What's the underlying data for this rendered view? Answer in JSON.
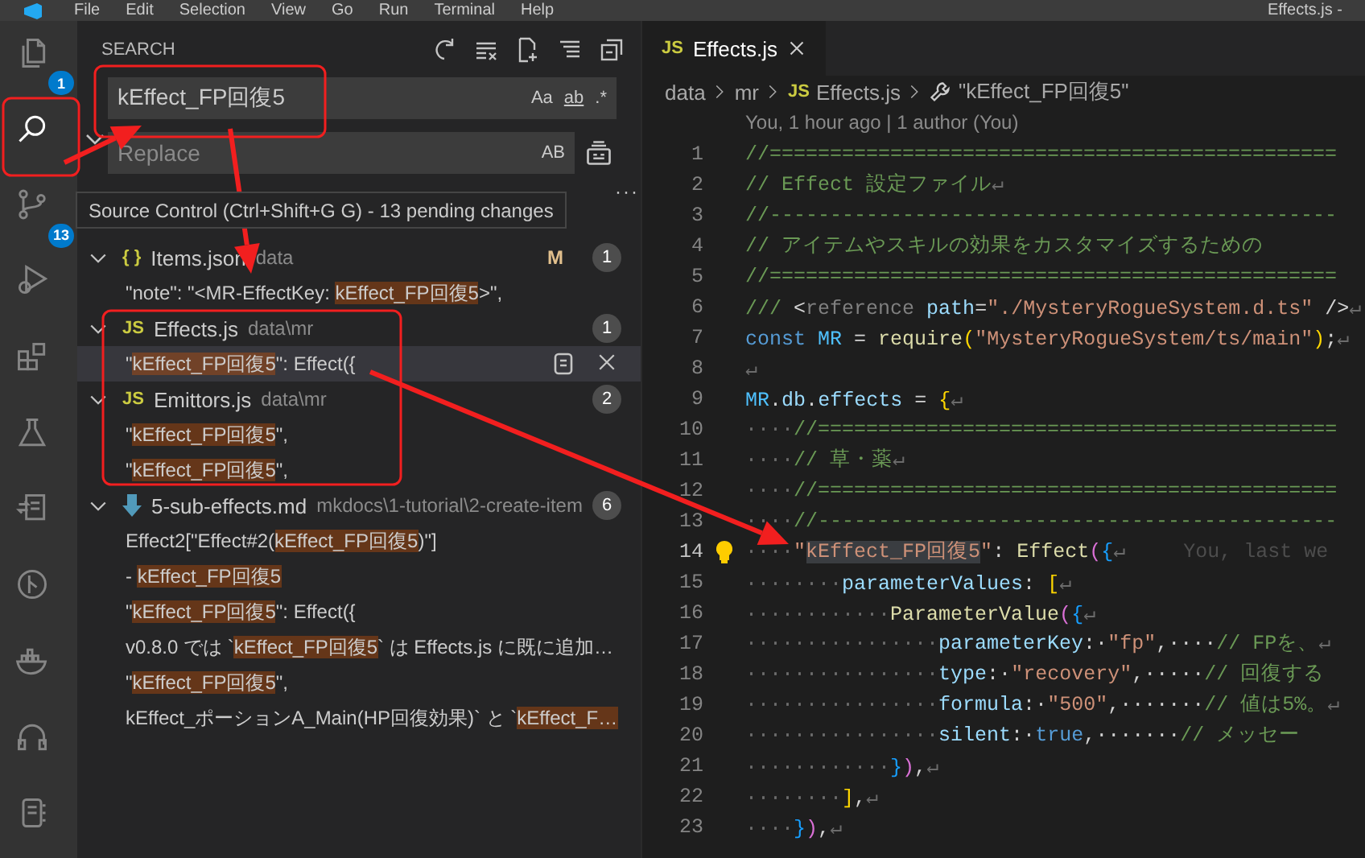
{
  "title_bar": {
    "menu": [
      "File",
      "Edit",
      "Selection",
      "View",
      "Go",
      "Run",
      "Terminal",
      "Help"
    ],
    "title": "Effects.js -"
  },
  "activity_bar": {
    "items": [
      {
        "kind": "explorer",
        "selected": false,
        "badge": "1"
      },
      {
        "kind": "search",
        "selected": true
      },
      {
        "kind": "scm",
        "selected": false,
        "badge": "13"
      },
      {
        "kind": "debug",
        "selected": false
      },
      {
        "kind": "extensions",
        "selected": false
      },
      {
        "kind": "testing",
        "selected": false
      },
      {
        "kind": "remote",
        "selected": false
      },
      {
        "kind": "graph",
        "selected": false
      },
      {
        "kind": "docker",
        "selected": false
      },
      {
        "kind": "headphones",
        "selected": false
      },
      {
        "kind": "notebook",
        "selected": false
      }
    ]
  },
  "tooltip": "Source Control (Ctrl+Shift+G G) - 13 pending changes",
  "sidebar": {
    "title": "SEARCH",
    "search": {
      "value": "kEffect_FP回復5",
      "options": [
        "Aa",
        "ab",
        ".*"
      ]
    },
    "replace": {
      "placeholder": "Replace",
      "options": [
        "AB"
      ]
    },
    "more": "···",
    "files": [
      {
        "name": "Items.json",
        "path": "data",
        "icon": {
          "kind": "json",
          "text": "{ }"
        },
        "status": "M",
        "count": "1",
        "expanded": true,
        "matches": [
          {
            "selected": false,
            "segments": [
              {
                "text": "\"note\": \"<MR-EffectKey: ",
                "match": false
              },
              {
                "text": "kEffect_FP回復5",
                "match": true
              },
              {
                "text": ">\",",
                "match": false
              }
            ]
          }
        ]
      },
      {
        "name": "Effects.js",
        "path": "data\\mr",
        "icon": {
          "kind": "js",
          "text": "JS"
        },
        "count": "1",
        "expanded": true,
        "matches": [
          {
            "selected": true,
            "segments": [
              {
                "text": "\"",
                "match": false
              },
              {
                "text": "kEffect_FP回復5",
                "match": true
              },
              {
                "text": "\": Effect({",
                "match": false
              }
            ]
          }
        ]
      },
      {
        "name": "Emittors.js",
        "path": "data\\mr",
        "icon": {
          "kind": "js",
          "text": "JS"
        },
        "count": "2",
        "expanded": true,
        "matches": [
          {
            "selected": false,
            "segments": [
              {
                "text": "\"",
                "match": false
              },
              {
                "text": "kEffect_FP回復5",
                "match": true
              },
              {
                "text": "\",",
                "match": false
              }
            ]
          },
          {
            "selected": false,
            "segments": [
              {
                "text": "\"",
                "match": false
              },
              {
                "text": "kEffect_FP回復5",
                "match": true
              },
              {
                "text": "\",",
                "match": false
              }
            ]
          }
        ]
      },
      {
        "name": "5-sub-effects.md",
        "path": "mkdocs\\1-tutorial\\2-create-item",
        "icon": {
          "kind": "markdown"
        },
        "count": "6",
        "expanded": true,
        "matches": [
          {
            "selected": false,
            "segments": [
              {
                "text": "Effect2[\"Effect#2(",
                "match": false
              },
              {
                "text": "kEffect_FP回復5",
                "match": true
              },
              {
                "text": ")\"]",
                "match": false
              }
            ]
          },
          {
            "selected": false,
            "segments": [
              {
                "text": "- ",
                "match": false
              },
              {
                "text": "kEffect_FP回復5",
                "match": true
              }
            ]
          },
          {
            "selected": false,
            "segments": [
              {
                "text": "\"",
                "match": false
              },
              {
                "text": "kEffect_FP回復5",
                "match": true
              },
              {
                "text": "\": Effect({",
                "match": false
              }
            ]
          },
          {
            "selected": false,
            "segments": [
              {
                "text": "v0.8.0 では `",
                "match": false
              },
              {
                "text": "kEffect_FP回復5",
                "match": true
              },
              {
                "text": "` は Effects.js に既に追加…",
                "match": false
              }
            ]
          },
          {
            "selected": false,
            "segments": [
              {
                "text": "\"",
                "match": false
              },
              {
                "text": "kEffect_FP回復5",
                "match": true
              },
              {
                "text": "\",",
                "match": false
              }
            ]
          },
          {
            "selected": false,
            "segments": [
              {
                "text": "kEffect_ポーションA_Main(HP回復効果)` と `",
                "match": false
              },
              {
                "text": "kEffect_F…",
                "match": true
              }
            ]
          }
        ]
      }
    ]
  },
  "editor": {
    "tabs": [
      {
        "label": "Effects.js",
        "icon": "JS",
        "selected": true
      }
    ],
    "breadcrumb": [
      {
        "kind": "folder",
        "text": "data"
      },
      {
        "kind": "folder",
        "text": "mr"
      },
      {
        "kind": "js",
        "icon": "JS",
        "text": "Effects.js"
      },
      {
        "kind": "symbol",
        "text": "\"kEffect_FP回復5\""
      }
    ],
    "blame": "You, 1 hour ago | 1 author (You)",
    "lines": [
      {
        "number": "1",
        "current": false,
        "lightbulb": false,
        "tokens": [
          {
            "kind": "comment",
            "text": "//==============================================="
          }
        ]
      },
      {
        "number": "2",
        "current": false,
        "lightbulb": false,
        "tokens": [
          {
            "kind": "comment",
            "text": "// Effect 設定ファイル"
          },
          {
            "kind": "eol",
            "text": "↵"
          }
        ]
      },
      {
        "number": "3",
        "current": false,
        "lightbulb": false,
        "tokens": [
          {
            "kind": "comment",
            "text": "//-----------------------------------------------"
          }
        ]
      },
      {
        "number": "4",
        "current": false,
        "lightbulb": false,
        "tokens": [
          {
            "kind": "comment",
            "text": "// アイテムやスキルの効果をカスタマイズするための"
          }
        ]
      },
      {
        "number": "5",
        "current": false,
        "lightbulb": false,
        "tokens": [
          {
            "kind": "comment",
            "text": "//==============================================="
          }
        ]
      },
      {
        "number": "6",
        "current": false,
        "lightbulb": false,
        "tokens": [
          {
            "kind": "comment",
            "text": "/// "
          },
          {
            "kind": "plain",
            "text": "<"
          },
          {
            "kind": "tag",
            "text": "reference"
          },
          {
            "kind": "property",
            "text": " path"
          },
          {
            "kind": "plain",
            "text": "="
          },
          {
            "kind": "string",
            "text": "\"./MysteryRogueSystem.d.ts\""
          },
          {
            "kind": "plain",
            "text": " />"
          },
          {
            "kind": "eol",
            "text": "↵"
          }
        ]
      },
      {
        "number": "7",
        "current": false,
        "lightbulb": false,
        "tokens": [
          {
            "kind": "keyword",
            "text": "const "
          },
          {
            "kind": "variable",
            "text": "MR"
          },
          {
            "kind": "plain",
            "text": " = "
          },
          {
            "kind": "function",
            "text": "require"
          },
          {
            "kind": "bracket",
            "text": "("
          },
          {
            "kind": "string",
            "text": "\"MysteryRogueSystem/ts/main\""
          },
          {
            "kind": "bracket",
            "text": ")"
          },
          {
            "kind": "plain",
            "text": ";"
          },
          {
            "kind": "eol",
            "text": "↵"
          }
        ]
      },
      {
        "number": "8",
        "current": false,
        "lightbulb": false,
        "tokens": [
          {
            "kind": "eol",
            "text": "↵"
          }
        ]
      },
      {
        "number": "9",
        "current": false,
        "lightbulb": false,
        "tokens": [
          {
            "kind": "variable",
            "text": "MR"
          },
          {
            "kind": "plain",
            "text": "."
          },
          {
            "kind": "property",
            "text": "db"
          },
          {
            "kind": "plain",
            "text": "."
          },
          {
            "kind": "property",
            "text": "effects"
          },
          {
            "kind": "plain",
            "text": " = "
          },
          {
            "kind": "bracket",
            "text": "{"
          },
          {
            "kind": "eol",
            "text": "↵"
          }
        ]
      },
      {
        "number": "10",
        "current": false,
        "lightbulb": false,
        "tokens": [
          {
            "kind": "whitespace",
            "text": "····"
          },
          {
            "kind": "comment",
            "text": "//==========================================="
          }
        ]
      },
      {
        "number": "11",
        "current": false,
        "lightbulb": false,
        "tokens": [
          {
            "kind": "whitespace",
            "text": "····"
          },
          {
            "kind": "comment",
            "text": "// 草・薬"
          },
          {
            "kind": "eol",
            "text": "↵"
          }
        ]
      },
      {
        "number": "12",
        "current": false,
        "lightbulb": false,
        "tokens": [
          {
            "kind": "whitespace",
            "text": "····"
          },
          {
            "kind": "comment",
            "text": "//==========================================="
          }
        ]
      },
      {
        "number": "13",
        "current": false,
        "lightbulb": false,
        "tokens": [
          {
            "kind": "whitespace",
            "text": "····"
          },
          {
            "kind": "comment",
            "text": "//-------------------------------------------"
          }
        ]
      },
      {
        "number": "14",
        "current": true,
        "lightbulb": true,
        "blame": "You, last we",
        "tokens": [
          {
            "kind": "whitespace",
            "text": "····"
          },
          {
            "kind": "string",
            "text": "\""
          },
          {
            "kind": "selection",
            "text": "kEffect_FP回復5"
          },
          {
            "kind": "string",
            "text": "\""
          },
          {
            "kind": "plain",
            "text": ": "
          },
          {
            "kind": "function",
            "text": "Effect"
          },
          {
            "kind": "bracket2",
            "text": "("
          },
          {
            "kind": "bracket3",
            "text": "{"
          },
          {
            "kind": "eol",
            "text": "↵"
          }
        ]
      },
      {
        "number": "15",
        "current": false,
        "lightbulb": false,
        "tokens": [
          {
            "kind": "whitespace",
            "text": "········"
          },
          {
            "kind": "property",
            "text": "parameterValues"
          },
          {
            "kind": "plain",
            "text": ": "
          },
          {
            "kind": "bracket",
            "text": "["
          },
          {
            "kind": "eol",
            "text": "↵"
          }
        ]
      },
      {
        "number": "16",
        "current": false,
        "lightbulb": false,
        "tokens": [
          {
            "kind": "whitespace",
            "text": "············"
          },
          {
            "kind": "function",
            "text": "ParameterValue"
          },
          {
            "kind": "bracket2",
            "text": "("
          },
          {
            "kind": "bracket3",
            "text": "{"
          },
          {
            "kind": "eol",
            "text": "↵"
          }
        ]
      },
      {
        "number": "17",
        "current": false,
        "lightbulb": false,
        "tokens": [
          {
            "kind": "whitespace",
            "text": "················"
          },
          {
            "kind": "property",
            "text": "parameterKey"
          },
          {
            "kind": "plain",
            "text": ":·"
          },
          {
            "kind": "string",
            "text": "\"fp\""
          },
          {
            "kind": "plain",
            "text": ",····"
          },
          {
            "kind": "comment",
            "text": "// FPを、"
          },
          {
            "kind": "eol",
            "text": "↵"
          }
        ]
      },
      {
        "number": "18",
        "current": false,
        "lightbulb": false,
        "tokens": [
          {
            "kind": "whitespace",
            "text": "················"
          },
          {
            "kind": "property",
            "text": "type"
          },
          {
            "kind": "plain",
            "text": ":·"
          },
          {
            "kind": "string",
            "text": "\"recovery\""
          },
          {
            "kind": "plain",
            "text": ",·····"
          },
          {
            "kind": "comment",
            "text": "// 回復する"
          }
        ]
      },
      {
        "number": "19",
        "current": false,
        "lightbulb": false,
        "tokens": [
          {
            "kind": "whitespace",
            "text": "················"
          },
          {
            "kind": "property",
            "text": "formula"
          },
          {
            "kind": "plain",
            "text": ":·"
          },
          {
            "kind": "string",
            "text": "\"500\""
          },
          {
            "kind": "plain",
            "text": ",·······"
          },
          {
            "kind": "comment",
            "text": "// 値は5%。"
          },
          {
            "kind": "eol",
            "text": "↵"
          }
        ]
      },
      {
        "number": "20",
        "current": false,
        "lightbulb": false,
        "tokens": [
          {
            "kind": "whitespace",
            "text": "················"
          },
          {
            "kind": "property",
            "text": "silent"
          },
          {
            "kind": "plain",
            "text": ":·"
          },
          {
            "kind": "keyword",
            "text": "true"
          },
          {
            "kind": "plain",
            "text": ",·······"
          },
          {
            "kind": "comment",
            "text": "// メッセー"
          }
        ]
      },
      {
        "number": "21",
        "current": false,
        "lightbulb": false,
        "tokens": [
          {
            "kind": "whitespace",
            "text": "············"
          },
          {
            "kind": "bracket3",
            "text": "}"
          },
          {
            "kind": "bracket2",
            "text": ")"
          },
          {
            "kind": "plain",
            "text": ","
          },
          {
            "kind": "eol",
            "text": "↵"
          }
        ]
      },
      {
        "number": "22",
        "current": false,
        "lightbulb": false,
        "tokens": [
          {
            "kind": "whitespace",
            "text": "········"
          },
          {
            "kind": "bracket",
            "text": "]"
          },
          {
            "kind": "plain",
            "text": ","
          },
          {
            "kind": "eol",
            "text": "↵"
          }
        ]
      },
      {
        "number": "23",
        "current": false,
        "lightbulb": false,
        "tokens": [
          {
            "kind": "whitespace",
            "text": "····"
          },
          {
            "kind": "bracket3",
            "text": "}"
          },
          {
            "kind": "bracket2",
            "text": ")"
          },
          {
            "kind": "plain",
            "text": ","
          },
          {
            "kind": "eol",
            "text": "↵"
          }
        ]
      }
    ]
  }
}
